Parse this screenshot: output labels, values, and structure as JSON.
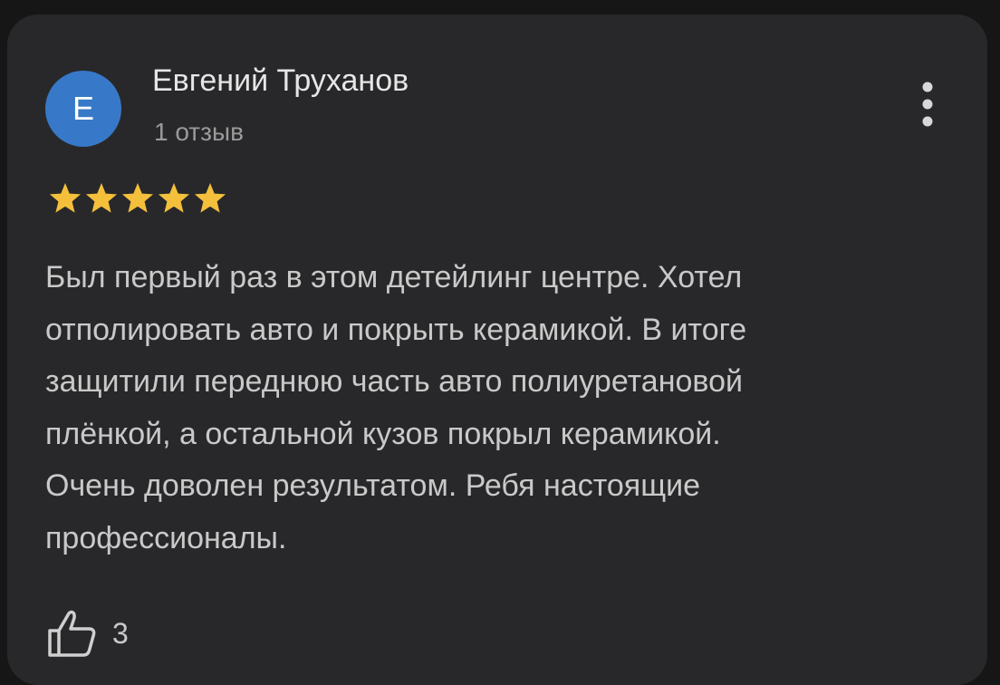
{
  "review": {
    "author": {
      "initial": "Е",
      "name": "Евгений Труханов",
      "review_count": "1 отзыв"
    },
    "rating": 5,
    "rating_max": 5,
    "text": "Был первый раз в этом детейлинг центре. Хотел\nотполировать авто и покрыть керамикой. В итоге\nзащитили переднюю часть авто полиуретановой\nплёнкой, а остальной кузов покрыл керамикой.\nОчень доволен результатом. Ребя настоящие\nпрофессионалы.",
    "likes": "3"
  },
  "icons": {
    "more": "more-vertical-icon",
    "star": "star-icon",
    "like": "thumbs-up-icon"
  },
  "colors": {
    "background": "#161616",
    "card": "#28282a",
    "avatar": "#3779c8",
    "star": "#f4c03c",
    "text_primary": "#e6e6e6",
    "text_secondary": "#9a9a9a",
    "text_body": "#c9c9c9"
  }
}
